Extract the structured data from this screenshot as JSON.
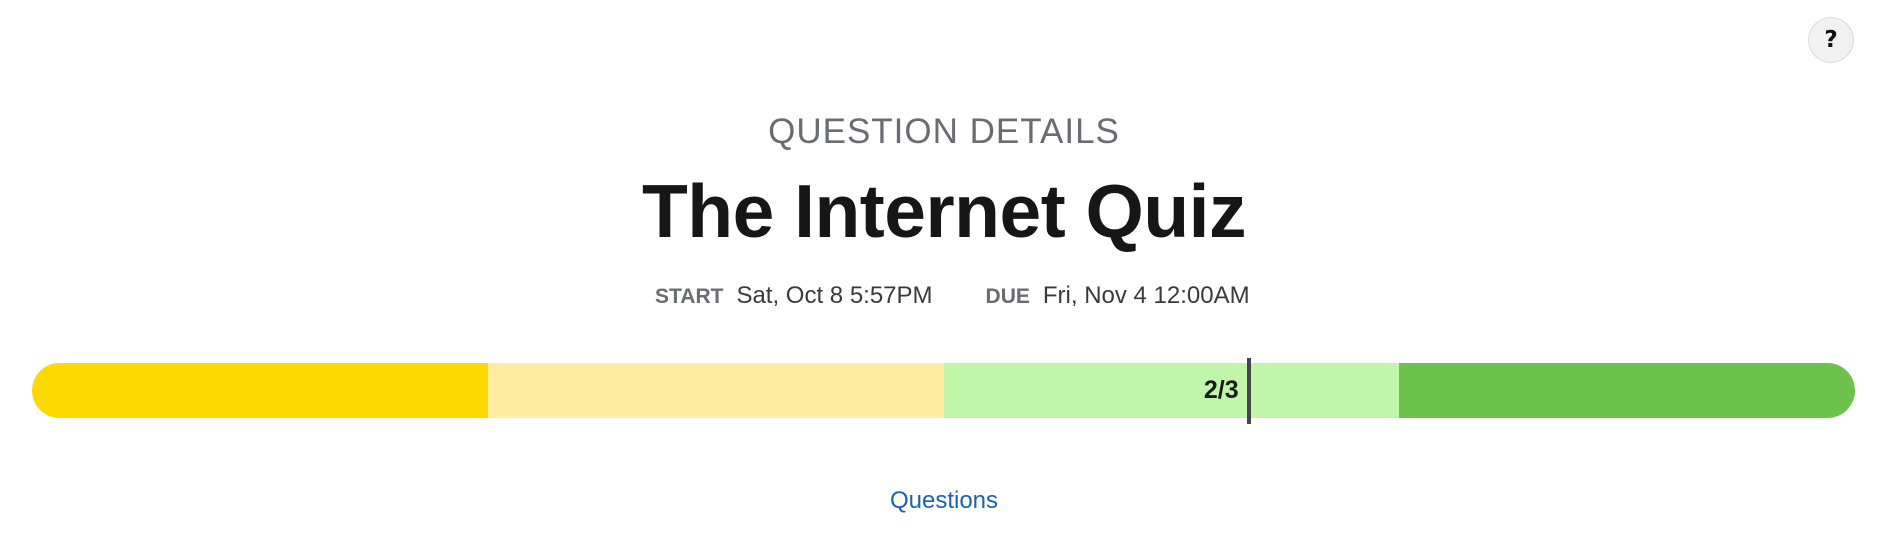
{
  "help": {
    "label": "?",
    "icon": "question-mark-icon"
  },
  "header": {
    "eyebrow": "QUESTION DETAILS",
    "title": "The Internet Quiz"
  },
  "schedule": {
    "start_label": "START",
    "start_value": "Sat, Oct 8 5:57PM",
    "due_label": "DUE",
    "due_value": "Fri, Nov 4 12:00AM"
  },
  "progress": {
    "label": "2/3",
    "marker_fraction": 0.6674,
    "segments": [
      {
        "fraction": 0.25,
        "color": "#fdd900"
      },
      {
        "fraction": 0.25,
        "color": "#feeca0"
      },
      {
        "fraction": 0.25,
        "color": "#c0f5aa"
      },
      {
        "fraction": 0.25,
        "color": "#6cc24a"
      }
    ]
  },
  "links": {
    "questions": "Questions"
  }
}
